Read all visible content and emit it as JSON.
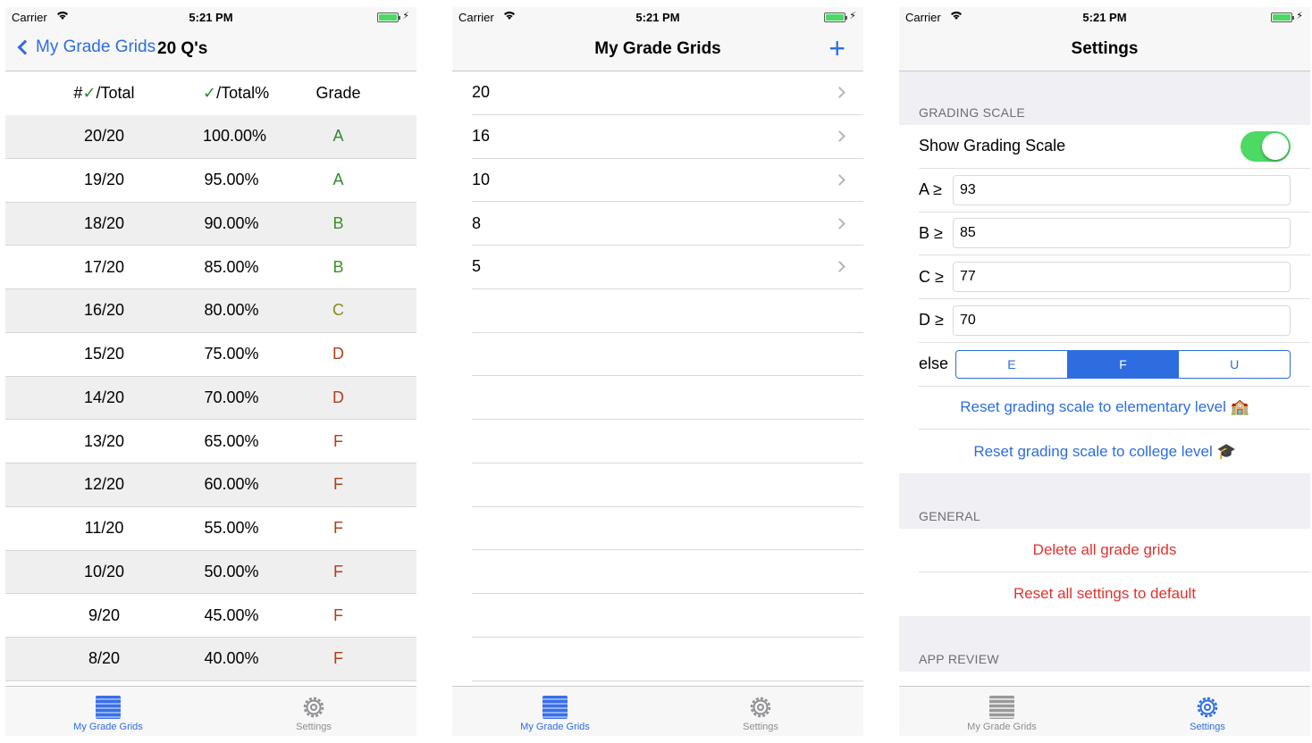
{
  "status": {
    "carrier": "Carrier",
    "time": "5:21 PM"
  },
  "screen1": {
    "back_label": "My Grade Grids",
    "title": "20 Q's",
    "headers": {
      "count_prefix": "#",
      "count_suffix": "/Total",
      "pct_suffix": "/Total%",
      "grade": "Grade"
    },
    "rows": [
      {
        "count": "20/20",
        "pct": "100.00%",
        "grade": "A",
        "cls": "gA"
      },
      {
        "count": "19/20",
        "pct": "95.00%",
        "grade": "A",
        "cls": "gA"
      },
      {
        "count": "18/20",
        "pct": "90.00%",
        "grade": "B",
        "cls": "gB"
      },
      {
        "count": "17/20",
        "pct": "85.00%",
        "grade": "B",
        "cls": "gB"
      },
      {
        "count": "16/20",
        "pct": "80.00%",
        "grade": "C",
        "cls": "gC"
      },
      {
        "count": "15/20",
        "pct": "75.00%",
        "grade": "D",
        "cls": "gD"
      },
      {
        "count": "14/20",
        "pct": "70.00%",
        "grade": "D",
        "cls": "gD"
      },
      {
        "count": "13/20",
        "pct": "65.00%",
        "grade": "F",
        "cls": "gF"
      },
      {
        "count": "12/20",
        "pct": "60.00%",
        "grade": "F",
        "cls": "gF"
      },
      {
        "count": "11/20",
        "pct": "55.00%",
        "grade": "F",
        "cls": "gF"
      },
      {
        "count": "10/20",
        "pct": "50.00%",
        "grade": "F",
        "cls": "gF"
      },
      {
        "count": "9/20",
        "pct": "45.00%",
        "grade": "F",
        "cls": "gF"
      },
      {
        "count": "8/20",
        "pct": "40.00%",
        "grade": "F",
        "cls": "gF"
      }
    ]
  },
  "screen2": {
    "title": "My Grade Grids",
    "items": [
      "20",
      "16",
      "10",
      "8",
      "5"
    ]
  },
  "screen3": {
    "title": "Settings",
    "grading_scale_header": "GRADING SCALE",
    "show_scale_label": "Show Grading Scale",
    "thresholds": [
      {
        "label": "A ≥",
        "value": "93"
      },
      {
        "label": "B ≥",
        "value": "85"
      },
      {
        "label": "C ≥",
        "value": "77"
      },
      {
        "label": "D ≥",
        "value": "70"
      }
    ],
    "else_label": "else",
    "else_options": [
      "E",
      "F",
      "U"
    ],
    "else_selected": "F",
    "reset_elementary": "Reset grading scale to elementary level 🏫",
    "reset_college": "Reset grading scale to college level 🎓",
    "general_header": "GENERAL",
    "delete_all": "Delete all grade grids",
    "reset_all": "Reset all settings to default",
    "app_review_header": "APP REVIEW"
  },
  "tabs": {
    "grids": "My Grade Grids",
    "settings": "Settings"
  },
  "colors": {
    "accent": "#2d6de0",
    "destructive": "#e0332f",
    "toggle_on": "#4cd964"
  }
}
